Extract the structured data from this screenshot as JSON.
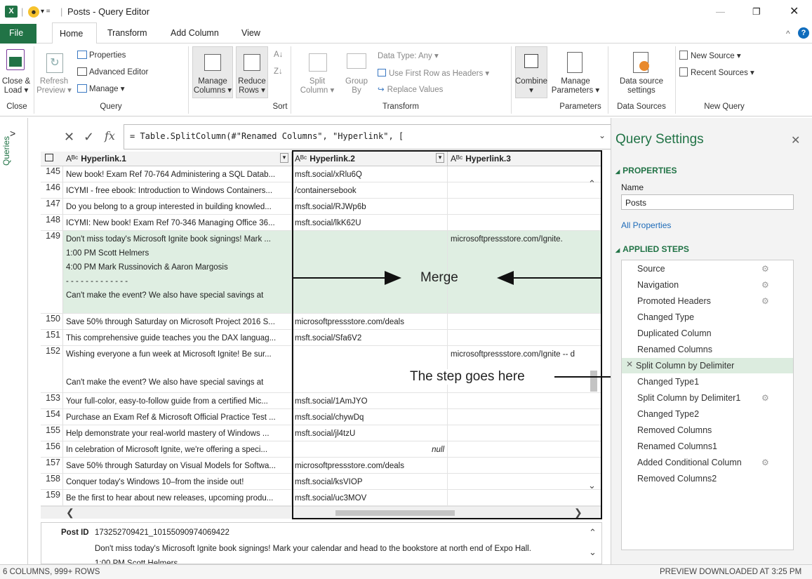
{
  "titlebar": {
    "title": "Posts - Query Editor",
    "separator": "|"
  },
  "tabs": [
    "File",
    "Home",
    "Transform",
    "Add Column",
    "View"
  ],
  "ribbon": {
    "close_load": [
      "Close &",
      "Load ▾"
    ],
    "refresh_preview": [
      "Refresh",
      "Preview ▾"
    ],
    "properties": "Properties",
    "advanced_editor": "Advanced Editor",
    "manage": "Manage ▾",
    "manage_columns": [
      "Manage",
      "Columns ▾"
    ],
    "reduce_rows": [
      "Reduce",
      "Rows ▾"
    ],
    "split_column": [
      "Split",
      "Column ▾"
    ],
    "group_by": [
      "Group",
      "By"
    ],
    "data_type": "Data Type: Any ▾",
    "use_first_row": "Use First Row as Headers ▾",
    "replace_values": "Replace Values",
    "combine": [
      "Combine",
      "▾"
    ],
    "manage_parameters": [
      "Manage",
      "Parameters ▾"
    ],
    "data_source_settings": [
      "Data source",
      "settings"
    ],
    "new_source": "New Source ▾",
    "recent_sources": "Recent Sources ▾",
    "groups": [
      "Close",
      "Query",
      "Sort",
      "Transform",
      "Parameters",
      "Data Sources",
      "New Query"
    ]
  },
  "leftpane": {
    "label": "Queries",
    "expand": ">"
  },
  "formula": {
    "text": "= Table.SplitColumn(#\"Renamed Columns\", \"Hyperlink\", [",
    "fx": "fx"
  },
  "columns": [
    {
      "type": "Aᴮᶜ",
      "name": "Hyperlink.1"
    },
    {
      "type": "Aᴮᶜ",
      "name": "Hyperlink.2"
    },
    {
      "type": "Aᴮᶜ",
      "name": "Hyperlink.3"
    }
  ],
  "rows": [
    {
      "n": "145",
      "c1": "New book! Exam Ref 70-764 Administering a SQL Datab...",
      "c2": "msft.social/xRlu6Q",
      "c3": ""
    },
    {
      "n": "146",
      "c1": "ICYMI - free ebook: Introduction to Windows Containers...",
      "c2": "/containersebook",
      "c3": ""
    },
    {
      "n": "147",
      "c1": "Do you belong to a group interested in building knowled...",
      "c2": "msft.social/RJWp6b",
      "c3": ""
    },
    {
      "n": "148",
      "c1": "ICYMI: New book! Exam Ref 70-346 Managing Office 36...",
      "c2": "msft.social/lkK62U",
      "c3": ""
    },
    {
      "n": "149",
      "c1": "Don't miss today's Microsoft Ignite book signings! Mark ...",
      "c2": "",
      "c3": "microsoftpressstore.com/Ignite."
    },
    {
      "n": "150",
      "c1": "Save 50% through Saturday on Microsoft Project 2016 S...",
      "c2": "microsoftpressstore.com/deals",
      "c3": ""
    },
    {
      "n": "151",
      "c1": "This comprehensive guide teaches you the DAX languag...",
      "c2": "msft.social/Sfa6V2",
      "c3": ""
    },
    {
      "n": "152",
      "c1": "Wishing everyone a fun week at Microsoft Ignite! Be sur...",
      "c2": "",
      "c3": "microsoftpressstore.com/Ignite -- d"
    },
    {
      "n": "153",
      "c1": "Your full-color, easy-to-follow guide from a certified Mic...",
      "c2": "msft.social/1AmJYO",
      "c3": ""
    },
    {
      "n": "154",
      "c1": "Purchase an Exam Ref & Microsoft Official Practice Test ...",
      "c2": "msft.social/chywDq",
      "c3": ""
    },
    {
      "n": "155",
      "c1": "Help demonstrate your real-world mastery of Windows ...",
      "c2": "msft.social/jl4tzU",
      "c3": ""
    },
    {
      "n": "156",
      "c1": "In celebration of Microsoft Ignite, we're offering a speci...",
      "c2": "null",
      "c3": ""
    },
    {
      "n": "157",
      "c1": "Save 50% through Saturday on Visual Models for Softwa...",
      "c2": "microsoftpressstore.com/deals",
      "c3": ""
    },
    {
      "n": "158",
      "c1": "Conquer today's Windows 10–from the inside out!",
      "c2": "msft.social/ksVIOP",
      "c3": ""
    },
    {
      "n": "159",
      "c1": "Be the first to hear about new releases, upcoming produ...",
      "c2": "msft.social/uc3MOV",
      "c3": ""
    }
  ],
  "row149_extra": [
    "1:00 PM Scott Helmers",
    "4:00 PM Mark Russinovich & Aaron Margosis",
    "- - - - - - - - - - - - -",
    "Can't make the event? We also have special savings at"
  ],
  "row152_extra": "Can't make the event? We also have special savings at",
  "annotations": {
    "merge": "Merge",
    "step": "The step goes here"
  },
  "preview": {
    "label": "Post ID",
    "post_id": "173252709421_10155090974069422",
    "text": "Don't miss today's Microsoft Ignite book signings! Mark your calendar and head to the bookstore at north end of Expo Hall.",
    "text2": "1:00 PM Scott Helmers"
  },
  "status": {
    "left": "6 COLUMNS, 999+ ROWS",
    "right": "PREVIEW DOWNLOADED AT 3:25 PM"
  },
  "query_settings": {
    "title": "Query Settings",
    "properties": "PROPERTIES",
    "name_label": "Name",
    "name_value": "Posts",
    "all_properties": "All Properties",
    "applied_steps": "APPLIED STEPS",
    "steps": [
      {
        "label": "Source",
        "gear": true
      },
      {
        "label": "Navigation",
        "gear": true
      },
      {
        "label": "Promoted Headers",
        "gear": true
      },
      {
        "label": "Changed Type",
        "gear": false
      },
      {
        "label": "Duplicated Column",
        "gear": false
      },
      {
        "label": "Renamed Columns",
        "gear": false
      },
      {
        "label": "Split Column by Delimiter",
        "gear": false,
        "selected": true
      },
      {
        "label": "Changed Type1",
        "gear": false
      },
      {
        "label": "Split Column by Delimiter1",
        "gear": true
      },
      {
        "label": "Changed Type2",
        "gear": false
      },
      {
        "label": "Removed Columns",
        "gear": false
      },
      {
        "label": "Renamed Columns1",
        "gear": false
      },
      {
        "label": "Added Conditional Column",
        "gear": true
      },
      {
        "label": "Removed Columns2",
        "gear": false
      }
    ]
  },
  "colors": {
    "accent": "#217346",
    "selected_row": "#dfeee2",
    "link": "#1e6bb8",
    "help": "#0f6cbd"
  }
}
